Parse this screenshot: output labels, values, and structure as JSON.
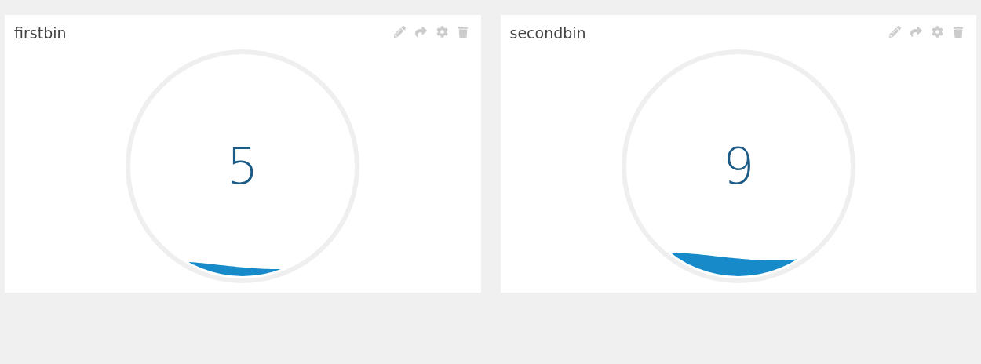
{
  "widgets": [
    {
      "title": "firstbin",
      "value": "5"
    },
    {
      "title": "secondbin",
      "value": "9"
    }
  ]
}
